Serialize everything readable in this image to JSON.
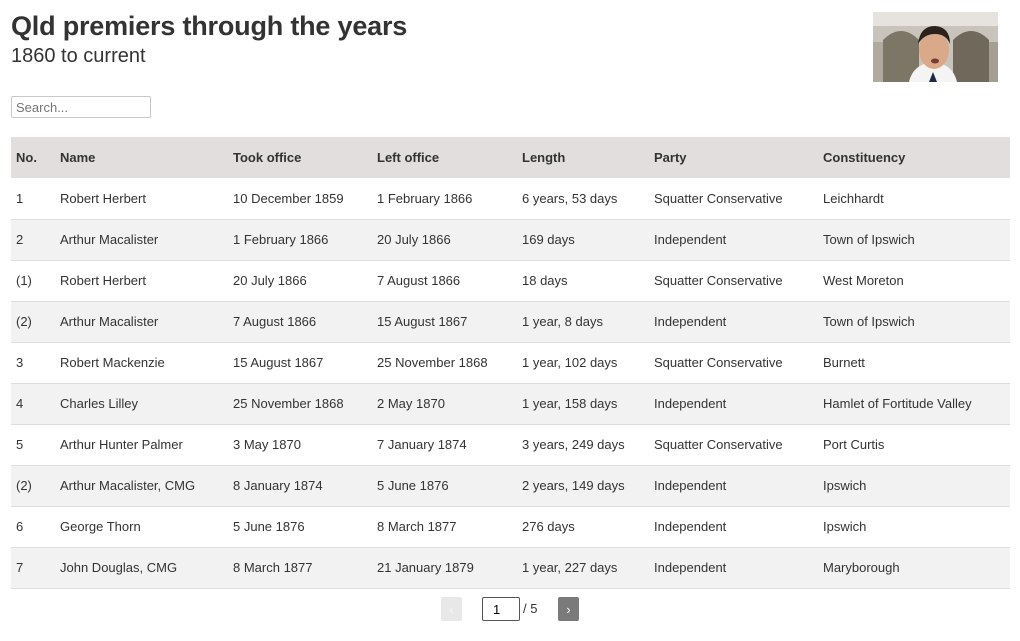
{
  "header": {
    "title": "Qld premiers through the years",
    "subtitle": "1860 to current"
  },
  "photo": {
    "alt": "Portrait of current Queensland premier"
  },
  "search": {
    "placeholder": "Search...",
    "value": ""
  },
  "table": {
    "columns": [
      "No.",
      "Name",
      "Took office",
      "Left office",
      "Length",
      "Party",
      "Constituency"
    ],
    "rows": [
      [
        "1",
        "Robert Herbert",
        "10 December 1859",
        "1 February 1866",
        "6 years, 53 days",
        "Squatter Conservative",
        "Leichhardt"
      ],
      [
        "2",
        "Arthur Macalister",
        "1 February 1866",
        "20 July 1866",
        "169 days",
        "Independent",
        "Town of Ipswich"
      ],
      [
        "(1)",
        "Robert Herbert",
        "20 July 1866",
        "7 August 1866",
        "18 days",
        "Squatter Conservative",
        "West Moreton"
      ],
      [
        "(2)",
        "Arthur Macalister",
        "7 August 1866",
        "15 August 1867",
        "1 year, 8 days",
        "Independent",
        "Town of Ipswich"
      ],
      [
        "3",
        "Robert Mackenzie",
        "15 August 1867",
        "25 November 1868",
        "1 year, 102 days",
        "Squatter Conservative",
        "Burnett"
      ],
      [
        "4",
        "Charles Lilley",
        "25 November 1868",
        "2 May 1870",
        "1 year, 158 days",
        "Independent",
        "Hamlet of Fortitude Valley"
      ],
      [
        "5",
        "Arthur Hunter Palmer",
        "3 May 1870",
        "7 January 1874",
        "3 years, 249 days",
        "Squatter Conservative",
        "Port Curtis"
      ],
      [
        "(2)",
        "Arthur Macalister, CMG",
        "8 January 1874",
        "5 June 1876",
        "2 years, 149 days",
        "Independent",
        "Ipswich"
      ],
      [
        "6",
        "George Thorn",
        "5 June 1876",
        "8 March 1877",
        "276 days",
        "Independent",
        "Ipswich"
      ],
      [
        "7",
        "John Douglas, CMG",
        "8 March 1877",
        "21 January 1879",
        "1 year, 227 days",
        "Independent",
        "Maryborough"
      ]
    ]
  },
  "pagination": {
    "prev_label": "‹",
    "next_label": "›",
    "current_page": "1",
    "total_label": "/ 5"
  }
}
